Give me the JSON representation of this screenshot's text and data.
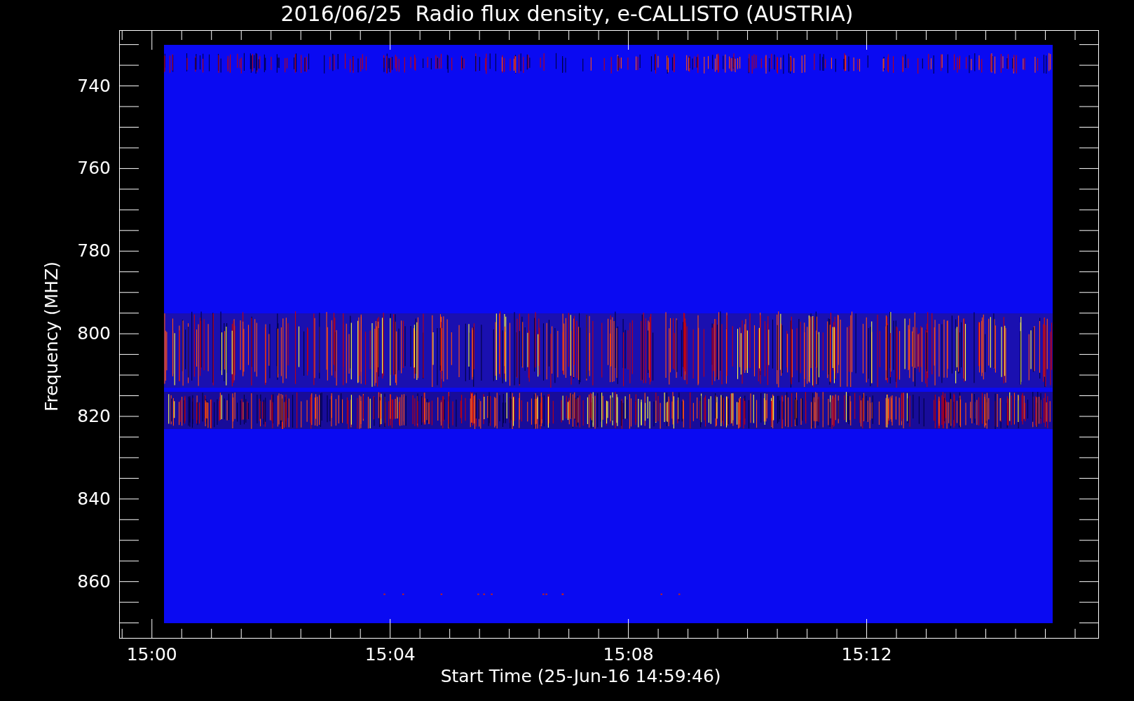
{
  "title": "2016/06/25  Radio flux density, e-CALLISTO (AUSTRIA)",
  "y_axis": {
    "label": "Frequency (MHZ)",
    "tick_labels": [
      "740",
      "760",
      "780",
      "800",
      "820",
      "840",
      "860"
    ]
  },
  "x_axis": {
    "label": "Start Time (25-Jun-16 14:59:46)",
    "tick_labels": [
      "15:00",
      "15:04",
      "15:08",
      "15:12"
    ]
  }
}
